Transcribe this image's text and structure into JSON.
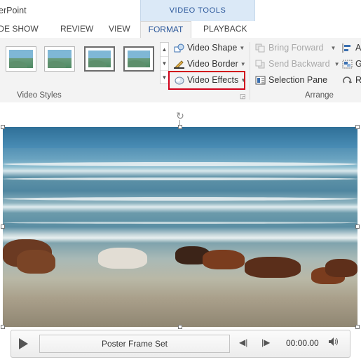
{
  "app": {
    "title_fragment": "erPoint"
  },
  "context_group": {
    "label": "VIDEO TOOLS"
  },
  "tabs": [
    {
      "label": "IDE SHOW"
    },
    {
      "label": "REVIEW"
    },
    {
      "label": "VIEW"
    },
    {
      "label": "FORMAT",
      "active": true
    },
    {
      "label": "PLAYBACK"
    }
  ],
  "ribbon": {
    "video_styles_label": "Video Styles",
    "video_shape": "Video Shape",
    "video_border": "Video Border",
    "video_effects": "Video Effects",
    "bring_forward": "Bring Forward",
    "send_backward": "Send Backward",
    "selection_pane": "Selection Pane",
    "arrange_label": "Arrange",
    "align_frag": "Al",
    "group_frag": "Gr",
    "rotate_frag": "Ro"
  },
  "player": {
    "poster_text": "Poster Frame Set",
    "time": "00:00.00"
  },
  "colors": {
    "accent": "#2b579a",
    "highlight": "#d0021b",
    "context_bg": "#dbe9f7"
  }
}
